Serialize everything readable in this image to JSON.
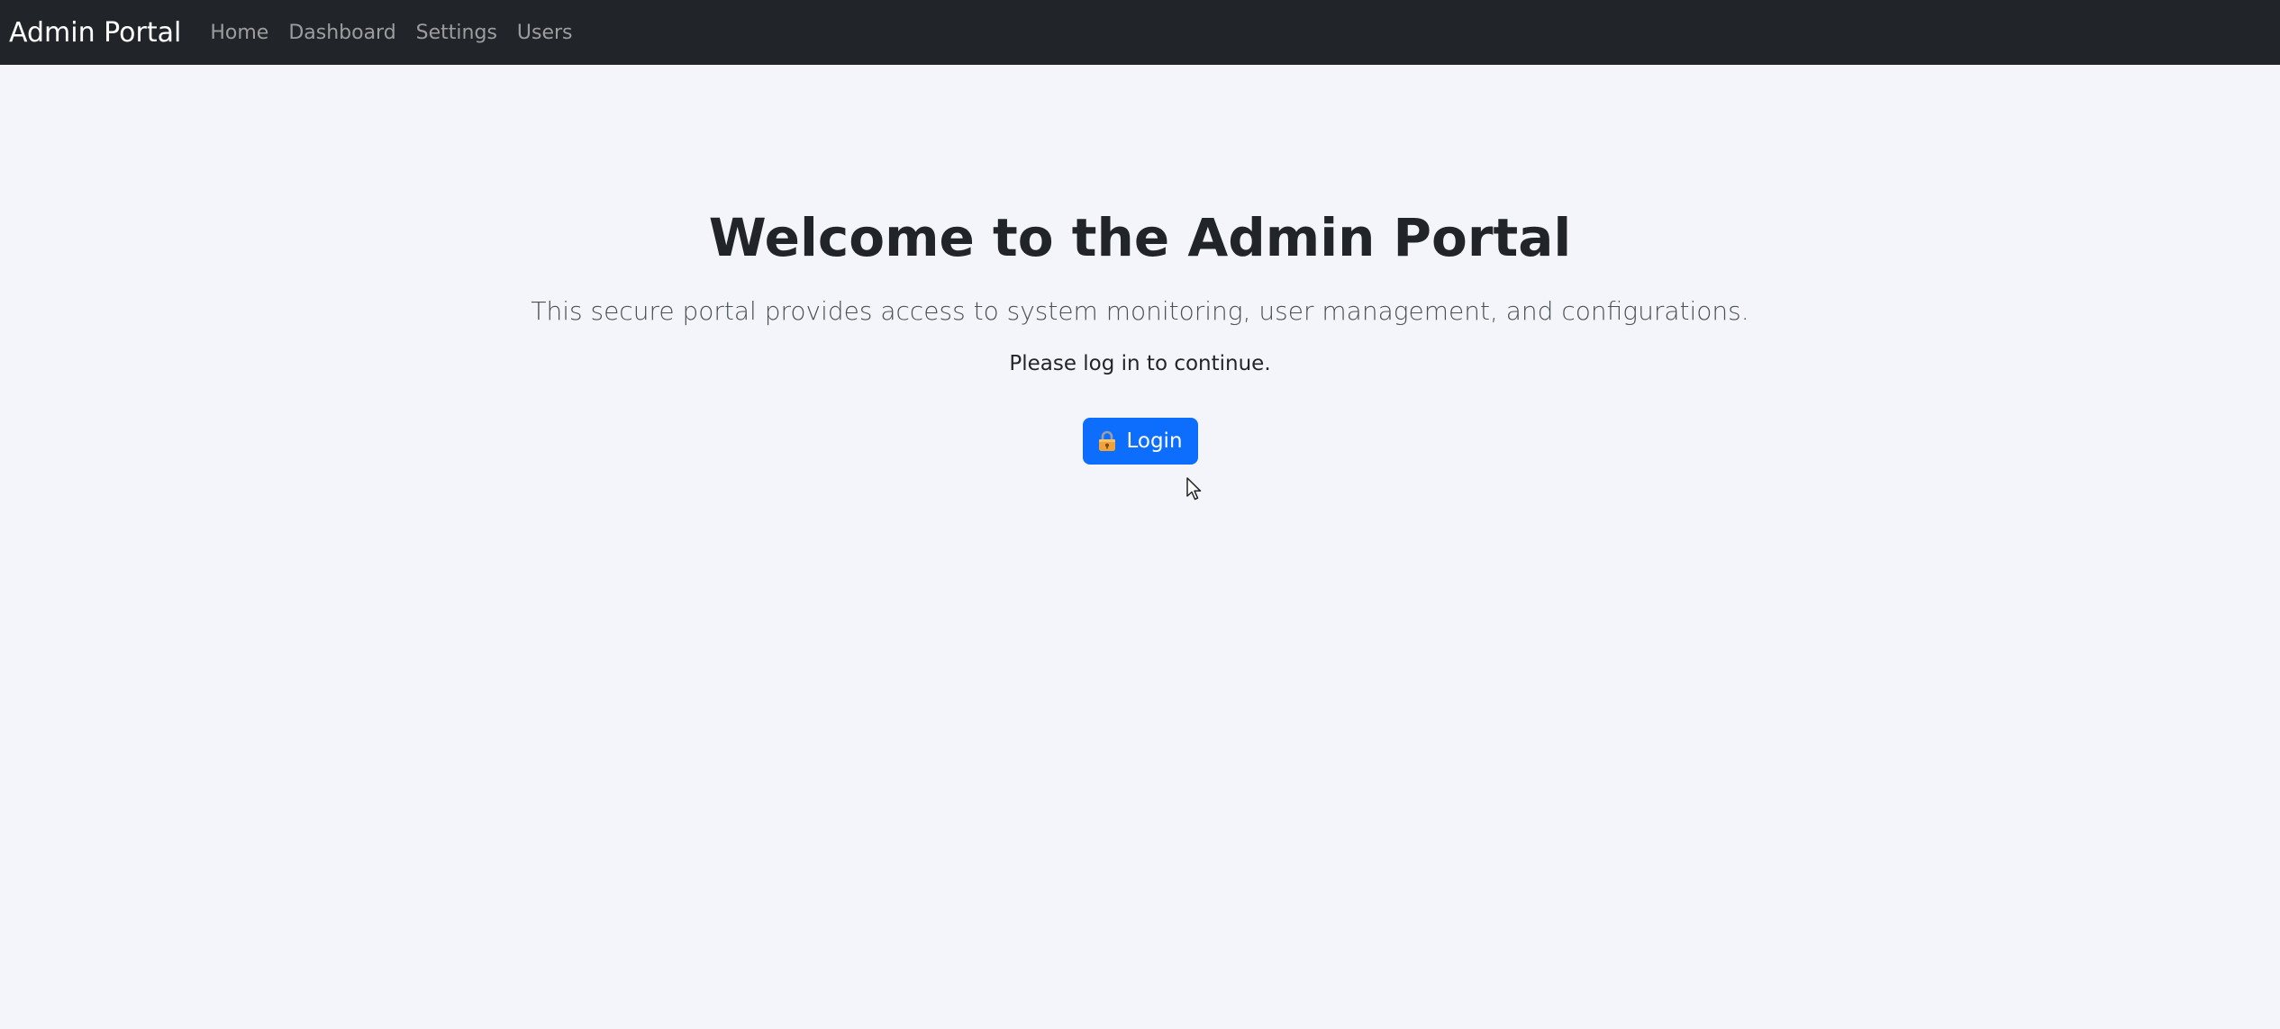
{
  "navbar": {
    "brand": "Admin Portal",
    "links": [
      {
        "label": "Home"
      },
      {
        "label": "Dashboard"
      },
      {
        "label": "Settings"
      },
      {
        "label": "Users"
      }
    ]
  },
  "main": {
    "title": "Welcome to the Admin Portal",
    "lead": "This secure portal provides access to system monitoring, user management, and configurations.",
    "note": "Please log in to continue.",
    "login_button": {
      "label": "Login",
      "icon": "lock-icon"
    }
  },
  "colors": {
    "navbar_bg": "#212529",
    "page_bg": "#f4f5fa",
    "primary": "#0d6efd"
  }
}
